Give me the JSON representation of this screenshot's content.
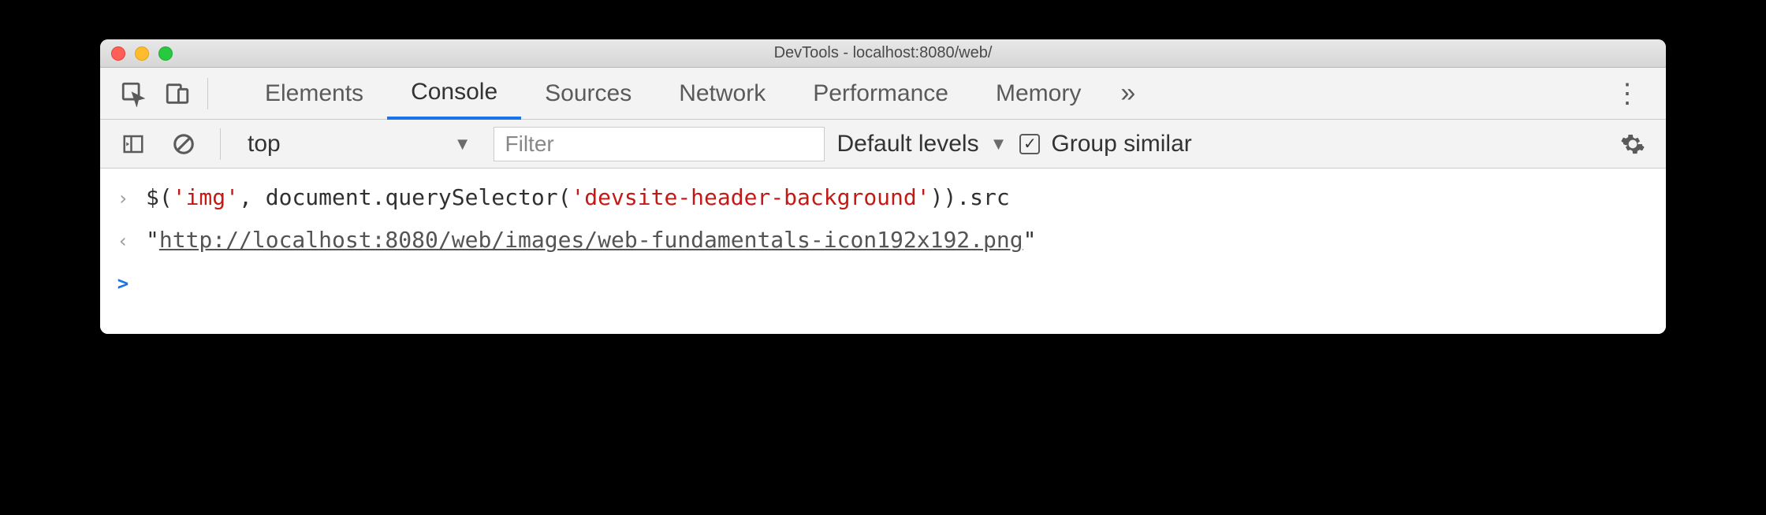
{
  "window": {
    "title": "DevTools - localhost:8080/web/"
  },
  "tabs": {
    "items": [
      "Elements",
      "Console",
      "Sources",
      "Network",
      "Performance",
      "Memory"
    ],
    "active": "Console"
  },
  "toolbar": {
    "context": "top",
    "filter_placeholder": "Filter",
    "levels_label": "Default levels",
    "group_similar_label": "Group similar",
    "group_similar_checked": true
  },
  "console": {
    "input_parts": {
      "p1": "$(",
      "s1": "'img'",
      "p2": ", document.querySelector(",
      "s2": "'devsite-header-background'",
      "p3": ")).src"
    },
    "output_quote": "\"",
    "output_url": "http://localhost:8080/web/images/web-fundamentals-icon192x192.png",
    "prompt": ">"
  }
}
